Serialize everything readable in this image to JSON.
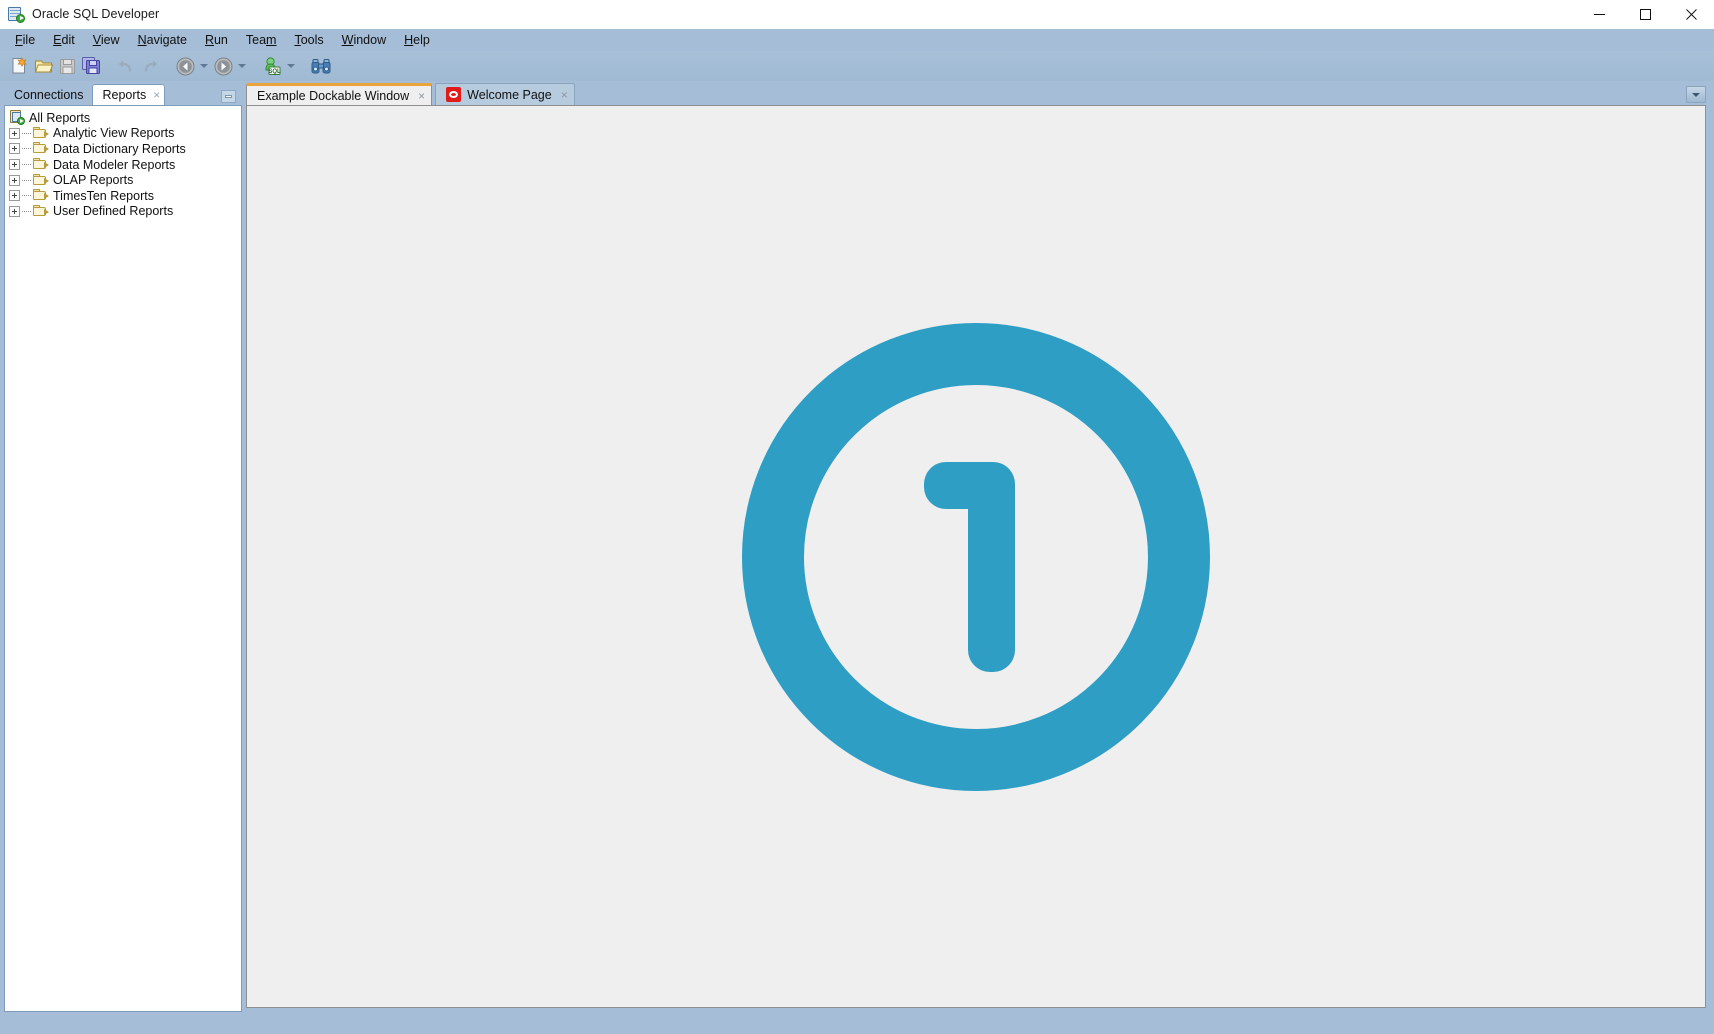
{
  "window": {
    "title": "Oracle SQL Developer",
    "app_icon": "sql-developer-icon",
    "controls": [
      {
        "name": "minimize-button",
        "glyph": "minimize-icon"
      },
      {
        "name": "maximize-button",
        "glyph": "maximize-icon"
      },
      {
        "name": "close-button",
        "glyph": "close-icon"
      }
    ]
  },
  "menubar": {
    "items": [
      {
        "label": "File",
        "mnemonic": "F"
      },
      {
        "label": "Edit",
        "mnemonic": "E"
      },
      {
        "label": "View",
        "mnemonic": "V"
      },
      {
        "label": "Navigate",
        "mnemonic": "N"
      },
      {
        "label": "Run",
        "mnemonic": "R"
      },
      {
        "label": "Team",
        "mnemonic": "m"
      },
      {
        "label": "Tools",
        "mnemonic": "T"
      },
      {
        "label": "Window",
        "mnemonic": "W"
      },
      {
        "label": "Help",
        "mnemonic": "H"
      }
    ]
  },
  "toolbar": {
    "buttons": [
      {
        "name": "new-button",
        "icon": "new-file-icon",
        "enabled": true
      },
      {
        "name": "open-button",
        "icon": "open-folder-icon",
        "enabled": true
      },
      {
        "name": "save-button",
        "icon": "save-icon",
        "enabled": false
      },
      {
        "name": "save-all-button",
        "icon": "save-all-icon",
        "enabled": true
      },
      {
        "name": "undo-button",
        "icon": "undo-arrow-icon",
        "enabled": false
      },
      {
        "name": "redo-button",
        "icon": "redo-arrow-icon",
        "enabled": false
      },
      {
        "name": "back-button",
        "icon": "back-arrow-icon",
        "enabled": true
      },
      {
        "name": "back-dropdown",
        "icon": "chevron-down-icon",
        "enabled": true
      },
      {
        "name": "forward-button",
        "icon": "forward-arrow-icon",
        "enabled": true
      },
      {
        "name": "forward-dropdown",
        "icon": "chevron-down-icon",
        "enabled": true
      },
      {
        "name": "new-sql-worksheet-button",
        "icon": "sql-worksheet-icon",
        "enabled": true
      },
      {
        "name": "sql-worksheet-dropdown",
        "icon": "chevron-down-icon",
        "enabled": true
      },
      {
        "name": "find-db-object-button",
        "icon": "binoculars-icon",
        "enabled": true
      }
    ]
  },
  "left_dock": {
    "tabs": [
      {
        "label": "Connections",
        "active": false,
        "closable": false
      },
      {
        "label": "Reports",
        "active": true,
        "closable": true,
        "close_glyph": "×"
      }
    ],
    "minimize_button": "minimize-panel-icon",
    "tree": {
      "root": {
        "label": "All Reports",
        "icon": "all-reports-icon"
      },
      "nodes": [
        {
          "label": "Analytic View Reports",
          "icon": "folder-icon",
          "expander": "plus-icon",
          "expanded": false
        },
        {
          "label": "Data Dictionary Reports",
          "icon": "folder-icon",
          "expander": "plus-icon",
          "expanded": false
        },
        {
          "label": "Data Modeler Reports",
          "icon": "folder-icon",
          "expander": "plus-icon",
          "expanded": false
        },
        {
          "label": "OLAP Reports",
          "icon": "folder-icon",
          "expander": "plus-icon",
          "expanded": false
        },
        {
          "label": "TimesTen Reports",
          "icon": "folder-icon",
          "expander": "plus-icon",
          "expanded": false
        },
        {
          "label": "User Defined Reports",
          "icon": "folder-icon",
          "expander": "plus-icon",
          "expanded": false
        }
      ]
    }
  },
  "editor_dock": {
    "tabs": [
      {
        "label": "Example Dockable Window",
        "active": true,
        "closable": true,
        "close_glyph": "×",
        "icon": null
      },
      {
        "label": "Welcome Page",
        "active": false,
        "closable": true,
        "close_glyph": "×",
        "icon": "welcome-page-icon"
      }
    ],
    "overflow_button": "chevron-down-icon",
    "content": {
      "graphic": "numbered-circle-one",
      "number_label": "1",
      "accent_color": "#2e9ec4",
      "background_color": "#efefef"
    }
  },
  "colors": {
    "chrome_blue": "#a5bdd6",
    "panel_white": "#ffffff",
    "editor_gray": "#efefef",
    "accent_blue": "#2e9ec4",
    "tab_active_top": "#e8a33d",
    "welcome_red": "#e21a1a"
  }
}
